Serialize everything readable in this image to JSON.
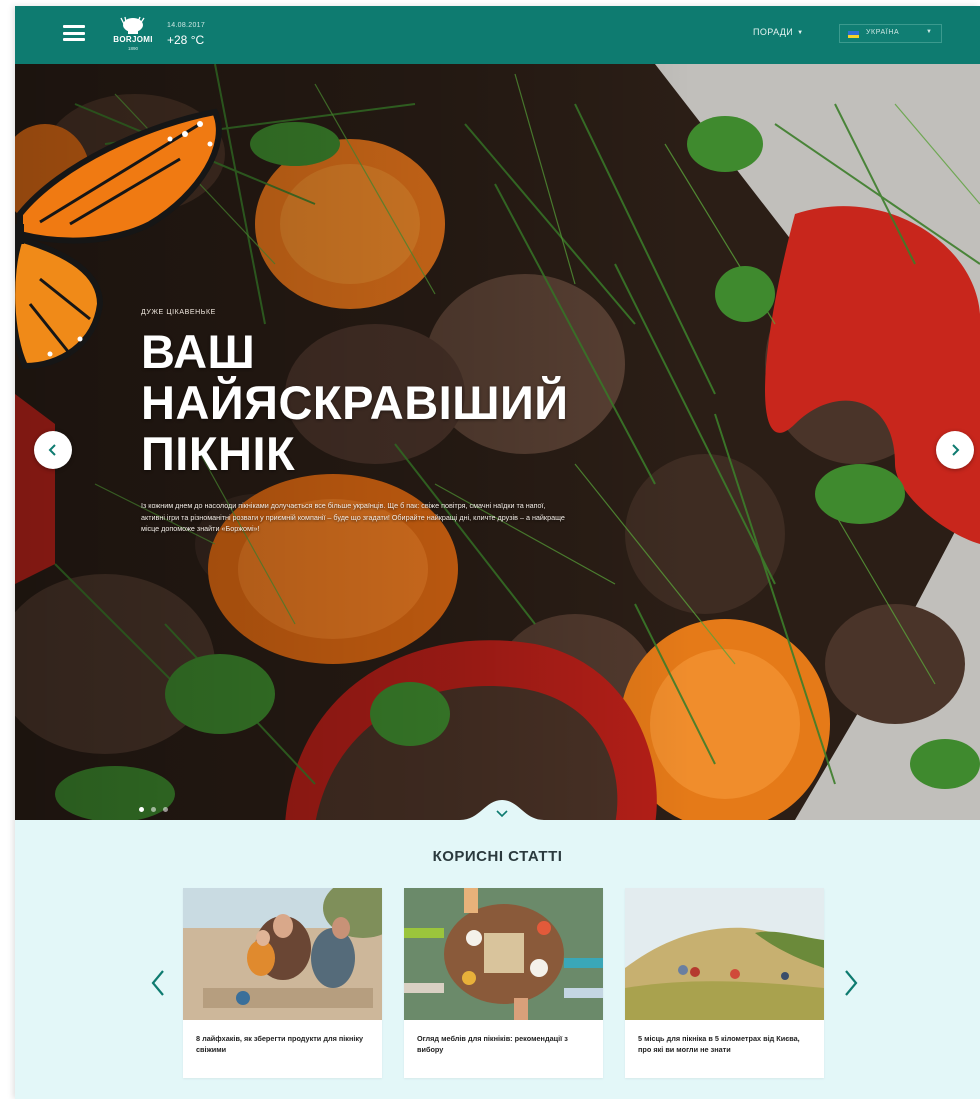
{
  "header": {
    "menu_icon": "hamburger-icon",
    "logo_text": "BORJOMI",
    "logo_sub": "1890",
    "date": "14.08.2017",
    "temperature": "+28 °C",
    "nav_tips_label": "ПОРАДИ",
    "country_label": "УКРАЇНА",
    "colors": {
      "header_bg": "#0e7b70",
      "flag_blue": "#2f6fd6",
      "flag_yellow": "#f5d329"
    }
  },
  "hero": {
    "kicker": "ДУЖЕ ЦІКАВЕНЬКЕ",
    "headline_lines": [
      "ВАШ",
      "НАЙЯСКРАВІШИЙ",
      "ПІКНІК"
    ],
    "text": "Із кожним днем до насолоди пікніками долучається все більше українців. Ще б пак: свіже повітря, смачні наїдки та напої, активні ігри та різноманітні розваги у приємній компанії – буде що згадати! Обирайте найкращі дні, кличте друзів – а найкраще місце допоможе знайти «Боржомі»!",
    "slides_total": 3,
    "active_slide": 1,
    "prev_icon": "chevron-left-icon",
    "next_icon": "chevron-right-icon",
    "scroll_icon": "chevron-down-icon"
  },
  "articles": {
    "title": "КОРИСНІ СТАТТІ",
    "prev_icon": "chevron-left-icon",
    "next_icon": "chevron-right-icon",
    "items": [
      {
        "title": "8 лайфхаків, як зберегти продукти для пікніку свіжими"
      },
      {
        "title": "Огляд меблів для пікніків: рекомендації з вибору"
      },
      {
        "title": "5 місць для пікніка в 5 кілометрах від Києва, про які ви могли не знати"
      }
    ],
    "colors": {
      "section_bg": "#e3f7f8",
      "accent": "#0e7b70"
    }
  }
}
